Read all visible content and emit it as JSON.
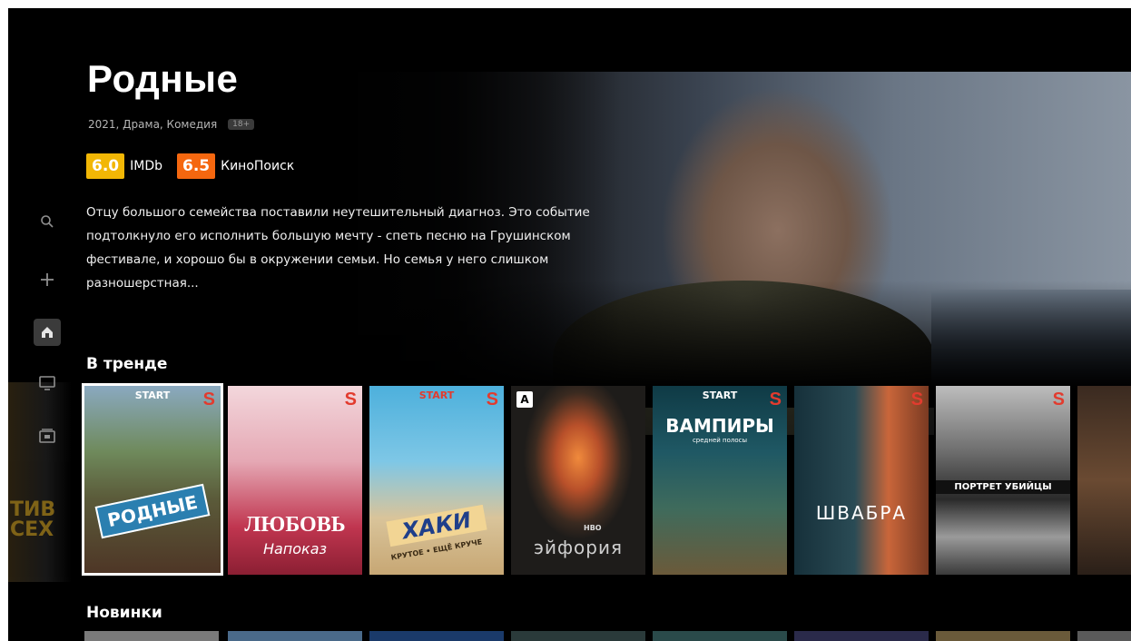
{
  "show": {
    "title": "Родные",
    "meta": "2021, Драма, Комедия",
    "age_rating": "18+",
    "ratings": [
      {
        "score": "6.0",
        "source": "IMDb",
        "color": "#f2b705"
      },
      {
        "score": "6.5",
        "source": "КиноПоиск",
        "color": "#f5670f"
      }
    ],
    "description": "Отцу большого семейства поставили неутешительный диагноз. Это событие подтолкнуло его исполнить большую мечту - спеть песню на Грушинском фестивале, и хорошо бы в окружении семьи. Но семья у него слишком разношерстная..."
  },
  "sidenav": {
    "items": [
      {
        "name": "search",
        "icon": "⌕"
      },
      {
        "name": "add",
        "icon": "+"
      },
      {
        "name": "home",
        "icon": "⌂",
        "active": true
      },
      {
        "name": "tv",
        "icon": "▭"
      },
      {
        "name": "media",
        "icon": "▣"
      }
    ]
  },
  "rows": {
    "trending_title": "В тренде",
    "new_title": "Новинки"
  },
  "posters": [
    {
      "caption": "РОДНЫЕ",
      "top_badge": "START",
      "badge": "S"
    },
    {
      "caption": "ЛЮБОВЬ",
      "subcaption": "Напоказ",
      "badge": "S"
    },
    {
      "caption": "ХАКИ",
      "subcaption": "КРУТОЕ • ЕЩЁ КРУЧЕ",
      "top_badge": "START",
      "badge": "S"
    },
    {
      "caption": "эйфория",
      "corner": "A",
      "network": "HBO"
    },
    {
      "caption": "ВАМПИРЫ",
      "subcaption": "средней полосы",
      "top_badge": "START",
      "badge": "S"
    },
    {
      "caption": "ШВАБРА",
      "badge": "S"
    },
    {
      "caption": "ПОРТРЕТ УБИЙЦЫ",
      "badge": "S"
    }
  ],
  "left_poster_ghost": "ТИВ\nСЕХ"
}
